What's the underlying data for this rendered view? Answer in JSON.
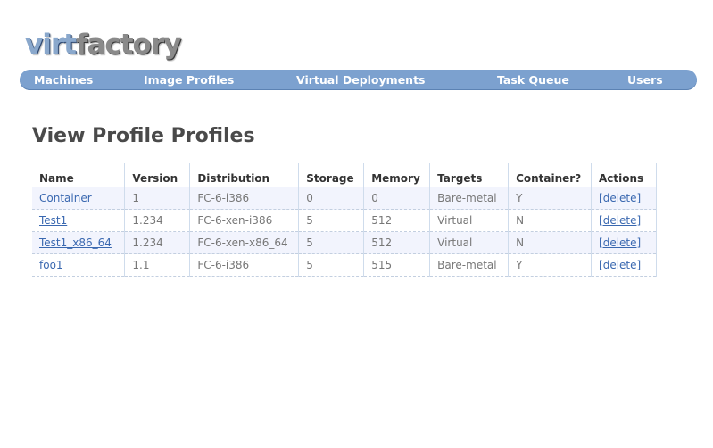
{
  "logo": {
    "part1": "virt",
    "part2": "factory"
  },
  "nav": [
    {
      "label": "Machines"
    },
    {
      "label": "Image Profiles"
    },
    {
      "label": "Virtual Deployments"
    },
    {
      "label": "Task Queue"
    },
    {
      "label": "Users"
    }
  ],
  "page": {
    "title": "View Profile Profiles"
  },
  "table": {
    "headers": [
      "Name",
      "Version",
      "Distribution",
      "Storage",
      "Memory",
      "Targets",
      "Container?",
      "Actions"
    ],
    "rows": [
      {
        "name": "Container",
        "version": "1",
        "distribution": "FC-6-i386",
        "storage": "0",
        "memory": "0",
        "targets": "Bare-metal",
        "container": "Y",
        "action": "[delete]"
      },
      {
        "name": "Test1",
        "version": "1.234",
        "distribution": "FC-6-xen-i386",
        "storage": "5",
        "memory": "512",
        "targets": "Virtual",
        "container": "N",
        "action": "[delete]"
      },
      {
        "name": "Test1_x86_64",
        "version": "1.234",
        "distribution": "FC-6-xen-x86_64",
        "storage": "5",
        "memory": "512",
        "targets": "Virtual",
        "container": "N",
        "action": "[delete]"
      },
      {
        "name": "foo1",
        "version": "1.1",
        "distribution": "FC-6-i386",
        "storage": "5",
        "memory": "515",
        "targets": "Bare-metal",
        "container": "Y",
        "action": "[delete]"
      }
    ]
  },
  "colors": {
    "nav_bg": "#7ca1cf",
    "link": "#3a68b0",
    "row_alt": "#f2f4fd"
  }
}
